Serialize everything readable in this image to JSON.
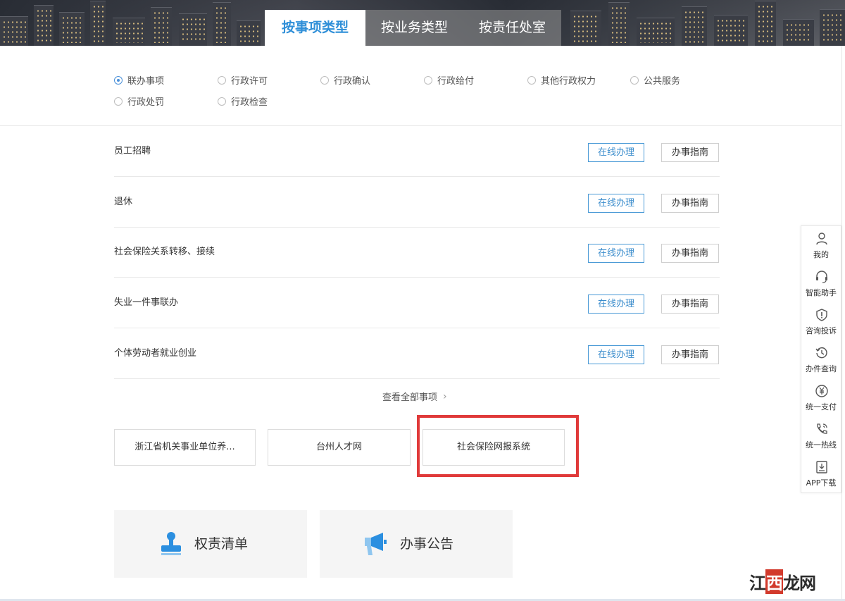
{
  "banner": {
    "tabs": [
      {
        "label": "按事项类型",
        "active": true
      },
      {
        "label": "按业务类型",
        "active": false
      },
      {
        "label": "按责任处室",
        "active": false
      }
    ]
  },
  "filters": [
    {
      "label": "联办事项",
      "checked": true
    },
    {
      "label": "行政许可",
      "checked": false
    },
    {
      "label": "行政确认",
      "checked": false
    },
    {
      "label": "行政给付",
      "checked": false
    },
    {
      "label": "其他行政权力",
      "checked": false
    },
    {
      "label": "公共服务",
      "checked": false
    },
    {
      "label": "行政处罚",
      "checked": false
    },
    {
      "label": "行政检查",
      "checked": false
    }
  ],
  "items": [
    {
      "name": "员工招聘",
      "online_label": "在线办理",
      "guide_label": "办事指南"
    },
    {
      "name": "退休",
      "online_label": "在线办理",
      "guide_label": "办事指南"
    },
    {
      "name": "社会保险关系转移、接续",
      "online_label": "在线办理",
      "guide_label": "办事指南"
    },
    {
      "name": "失业一件事联办",
      "online_label": "在线办理",
      "guide_label": "办事指南"
    },
    {
      "name": "个体劳动者就业创业",
      "online_label": "在线办理",
      "guide_label": "办事指南"
    }
  ],
  "view_all": "查看全部事项",
  "system_links": [
    {
      "label": "浙江省机关事业单位养..."
    },
    {
      "label": "台州人才网"
    },
    {
      "label": "社会保险网报系统",
      "highlighted": true
    }
  ],
  "cards": [
    {
      "label": "权责清单",
      "icon": "stamp-icon"
    },
    {
      "label": "办事公告",
      "icon": "megaphone-icon"
    }
  ],
  "sidebar": [
    {
      "label": "我的",
      "icon": "user-icon"
    },
    {
      "label": "智能助手",
      "icon": "headset-icon"
    },
    {
      "label": "咨询投诉",
      "icon": "shield-alert-icon"
    },
    {
      "label": "办件查询",
      "icon": "history-icon"
    },
    {
      "label": "统一支付",
      "icon": "yuan-icon"
    },
    {
      "label": "统一热线",
      "icon": "phone-icon"
    },
    {
      "label": "APP下载",
      "icon": "download-icon"
    }
  ],
  "colors": {
    "accent": "#2f8fd8",
    "highlight_border": "#e03a3a",
    "card_icon": "#2b8fe0"
  },
  "watermark": {
    "brand_left": "江",
    "brand_mark": "西",
    "brand_right": "龙网"
  }
}
